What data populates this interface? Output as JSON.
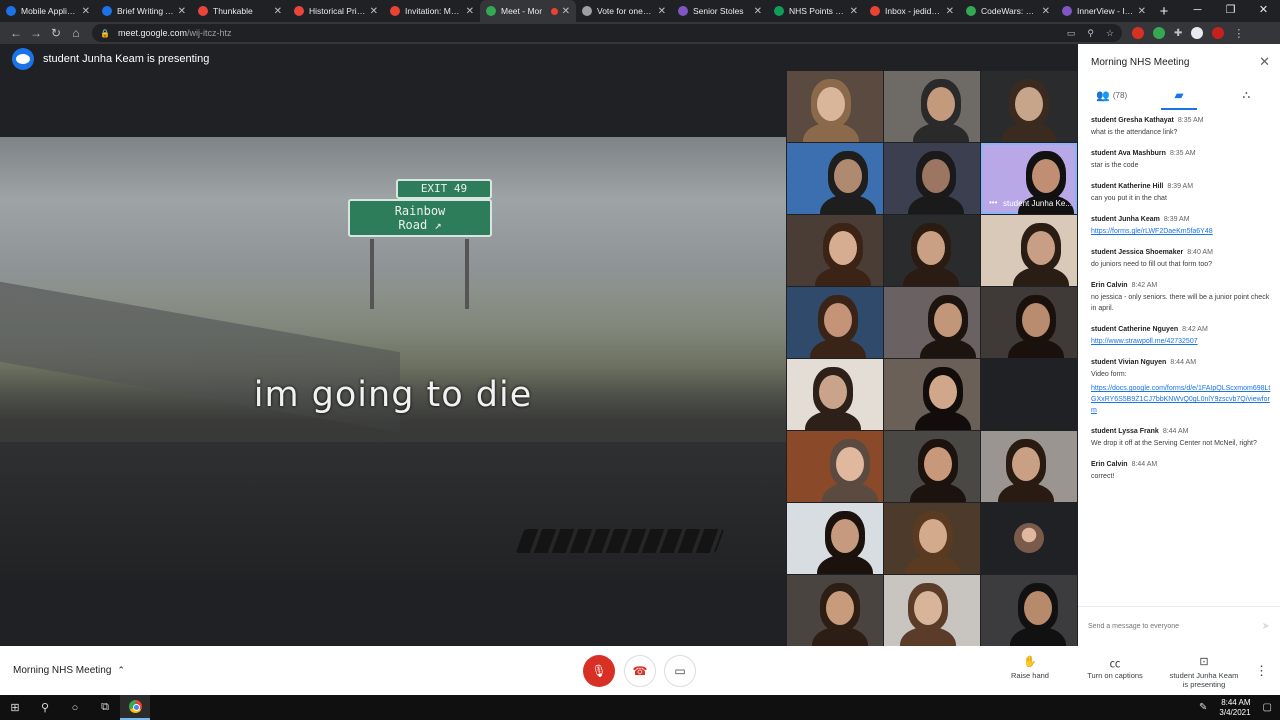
{
  "browser": {
    "tabs": [
      {
        "label": "Mobile Applicati",
        "color": "#1a73e8",
        "active": false
      },
      {
        "label": "Brief Writing As",
        "color": "#1a73e8",
        "active": false
      },
      {
        "label": "Thunkable",
        "color": "#e8453c",
        "active": false
      },
      {
        "label": "Historical Prices",
        "color": "#e8453c",
        "active": false
      },
      {
        "label": "Invitation: Morn",
        "color": "#ea4335",
        "active": false
      },
      {
        "label": "Meet - Mor",
        "color": "#34a853",
        "active": true
      },
      {
        "label": "Vote for one Go",
        "color": "#9aa0a6",
        "active": false
      },
      {
        "label": "Senior Stoles",
        "color": "#7e57c2",
        "active": false
      },
      {
        "label": "NHS Points She",
        "color": "#0f9d58",
        "active": false
      },
      {
        "label": "Inbox - jedidiah",
        "color": "#ea4335",
        "active": false
      },
      {
        "label": "CodeWars: Sam",
        "color": "#34a853",
        "active": false
      },
      {
        "label": "InnerView - Inne",
        "color": "#7e57c2",
        "active": false
      }
    ],
    "url_host": "meet.google.com",
    "url_path": "/wij-itcz-htz"
  },
  "stage": {
    "presenter_label": "student Junha Keam is presenting",
    "screen": {
      "sign_exit": "EXIT 49",
      "sign_line1": "Rainbow",
      "sign_line2": "Road ↗",
      "caption": "im going to die"
    },
    "tiles": [
      {
        "bg": "#5b4a3f",
        "face": "#d9b59a",
        "hair": "#8a6a4a"
      },
      {
        "bg": "#6e6a66",
        "face": "#c49a7c",
        "hair": "#2a2a2a"
      },
      {
        "bg": "#2a2b2d",
        "face": "#c7a58b",
        "hair": "#3a2a20"
      },
      {
        "bg": "#3b6fb0",
        "face": "#b08a70",
        "hair": "#1e1e1e"
      },
      {
        "bg": "#3b3f4f",
        "face": "#9c7662",
        "hair": "#1a1a1a"
      },
      {
        "bg": "#b9a8e8",
        "face": "#c08e72",
        "hair": "#111",
        "name": "student Junha Ke...",
        "speaking": true
      },
      {
        "bg": "#4a3d36",
        "face": "#d7ad92",
        "hair": "#3b2316"
      },
      {
        "bg": "#2a2b2d",
        "face": "#caa085",
        "hair": "#2b1c13"
      },
      {
        "bg": "#d9c9b8",
        "face": "#c89e84",
        "hair": "#2a1d14"
      },
      {
        "bg": "#2f4a6a",
        "face": "#c49378",
        "hair": "#3a2418"
      },
      {
        "bg": "#6a6262",
        "face": "#c29679",
        "hair": "#1d140f"
      },
      {
        "bg": "#3f3a38",
        "face": "#b98c6f",
        "hair": "#1a110c"
      },
      {
        "bg": "#e3ddd6",
        "face": "#c9a48a",
        "hair": "#2d2019"
      },
      {
        "bg": "#6b6058",
        "face": "#d0a78a",
        "hair": "#120d0a"
      },
      {
        "bg": "#202124",
        "empty": true
      },
      {
        "bg": "#8a4a2a",
        "face": "#e0b89e",
        "hair": "#5a4a40"
      },
      {
        "bg": "#4a4845",
        "face": "#c7987a",
        "hair": "#1c130e"
      },
      {
        "bg": "#9a9590",
        "face": "#caa085",
        "hair": "#2a1b12"
      },
      {
        "bg": "#d8dde2",
        "face": "#c69a7e",
        "hair": "#1b120d"
      },
      {
        "bg": "#4c3a2a",
        "face": "#d3aa8c",
        "hair": "#5a3a20"
      },
      {
        "bg": "#202124",
        "avatar": true
      },
      {
        "bg": "#4a4440",
        "face": "#c99b7d",
        "hair": "#2d1e15"
      },
      {
        "bg": "#c8c4c0",
        "face": "#d9b39a",
        "hair": "#5a3c28"
      },
      {
        "bg": "#3c3c3e",
        "face": "#b88a6c",
        "hair": "#111"
      }
    ]
  },
  "panel": {
    "title": "Morning NHS Meeting",
    "people_count": "(78)",
    "compose_placeholder": "Send a message to everyone",
    "messages": [
      {
        "sender": "student Gresha Kathayat",
        "time": "8:35 AM",
        "lines": [
          {
            "text": "what is the attendance link?",
            "link": false
          }
        ]
      },
      {
        "sender": "student Ava Mashburn",
        "time": "8:35 AM",
        "lines": [
          {
            "text": "star is the code",
            "link": false
          }
        ]
      },
      {
        "sender": "student Katherine Hill",
        "time": "8:39 AM",
        "lines": [
          {
            "text": "can you put it in the chat",
            "link": false
          }
        ]
      },
      {
        "sender": "student Junha Keam",
        "time": "8:39 AM",
        "lines": [
          {
            "text": "https://forms.gle/rLWF2DaeKm5fa6Y48",
            "link": true
          }
        ]
      },
      {
        "sender": "student Jessica Shoemaker",
        "time": "8:40 AM",
        "lines": [
          {
            "text": "do juniors need to fill out that form too?",
            "link": false
          }
        ]
      },
      {
        "sender": "Erin Calvin",
        "time": "8:42 AM",
        "lines": [
          {
            "text": "no jessica - only seniors.  there will be a junior point check in april.",
            "link": false
          }
        ]
      },
      {
        "sender": "student Catherine Nguyen",
        "time": "8:42 AM",
        "lines": [
          {
            "text": "http://www.strawpoll.me/42732507",
            "link": true
          }
        ]
      },
      {
        "sender": "student Vivian Nguyen",
        "time": "8:44 AM",
        "lines": [
          {
            "text": "Video form:",
            "link": false
          },
          {
            "text": "https://docs.google.com/forms/d/e/1FAIpQLScxmom698LtGXxRY6S5B9Z1CJ7bbKNWvQ0gL0nlY9zscvb7Q/viewform",
            "link": true
          }
        ]
      },
      {
        "sender": "student Lyssa Frank",
        "time": "8:44 AM",
        "lines": [
          {
            "text": "We drop it off at the Serving Center not McNeil, right?",
            "link": false
          }
        ]
      },
      {
        "sender": "Erin Calvin",
        "time": "8:44 AM",
        "lines": [
          {
            "text": "correct!",
            "link": false
          }
        ]
      }
    ]
  },
  "bottom": {
    "meeting_name": "Morning NHS Meeting",
    "raise_hand": "Raise hand",
    "captions": "Turn on captions",
    "presenting_line1": "student Junha Keam",
    "presenting_line2": "is presenting"
  },
  "taskbar": {
    "time": "8:44 AM",
    "date": "3/4/2021"
  }
}
